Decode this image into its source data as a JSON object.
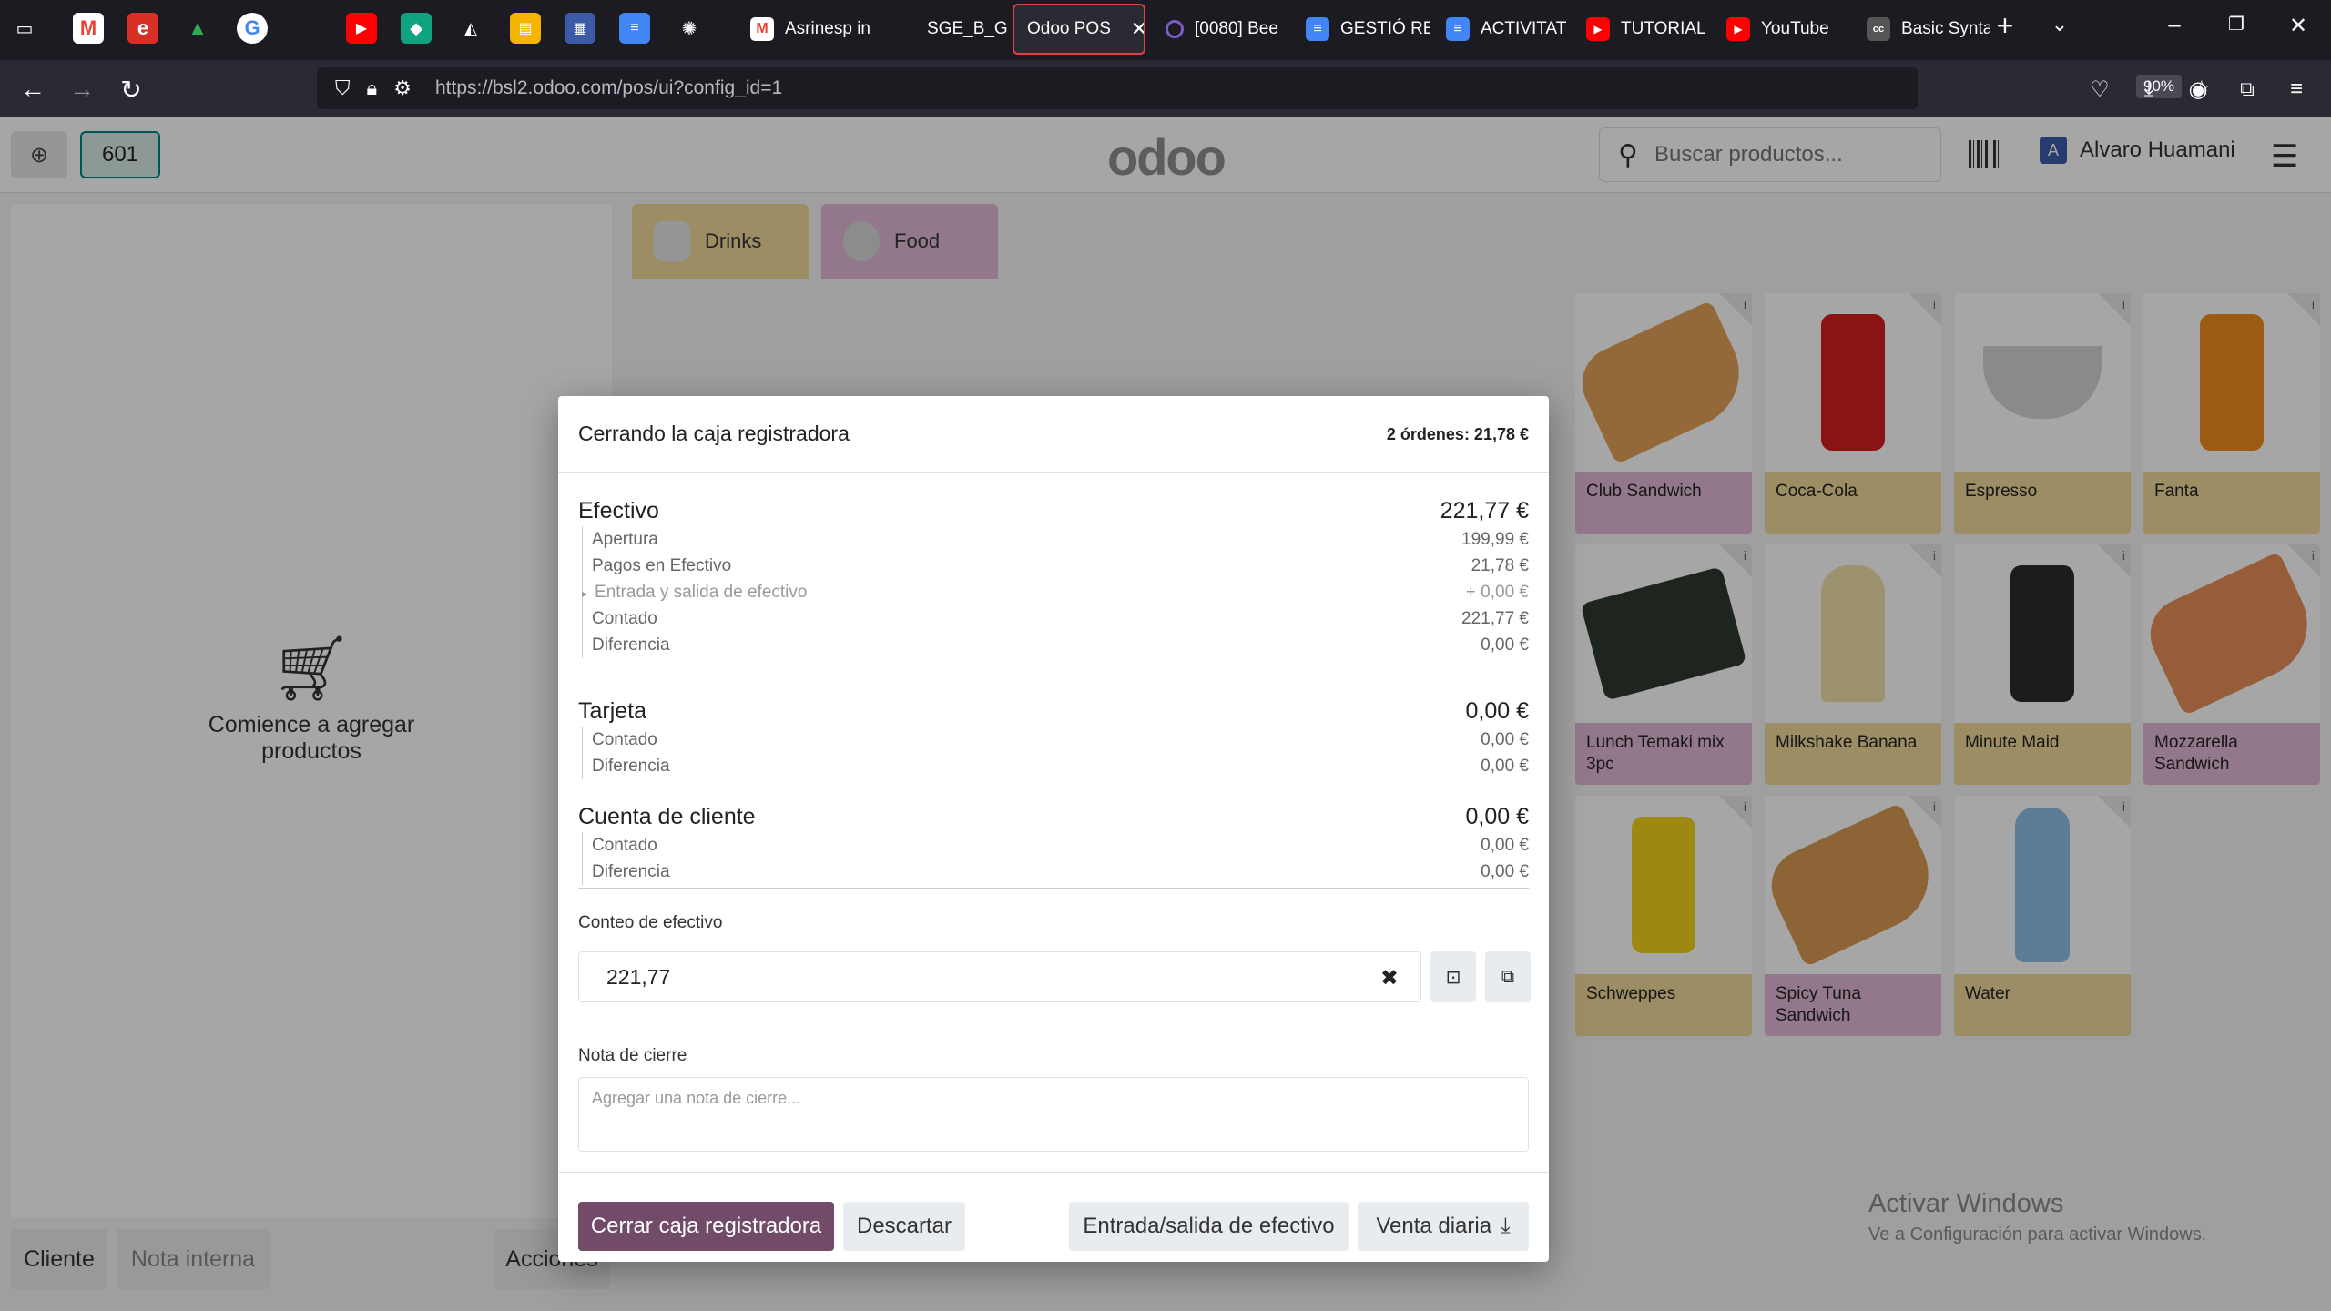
{
  "browser": {
    "tabs": [
      {
        "label": "Asrinesp in",
        "icon": "gmail-icon",
        "color": "#ea4335"
      },
      {
        "label": "SGE_B_GR",
        "icon": "odoo-icon",
        "color": "#714b67"
      },
      {
        "label": "Odoo POS",
        "icon": "",
        "color": "#714b67"
      },
      {
        "label": "[0080] Bee",
        "icon": "circle-icon",
        "color": "#7a5cc7"
      },
      {
        "label": "GESTIÓ RE",
        "icon": "docs-icon",
        "color": "#4285f4"
      },
      {
        "label": "ACTIVITAT",
        "icon": "docs-icon",
        "color": "#4285f4"
      },
      {
        "label": "TUTORIAL",
        "icon": "youtube-icon",
        "color": "#ff0000"
      },
      {
        "label": "YouTube",
        "icon": "youtube-icon",
        "color": "#ff0000"
      },
      {
        "label": "Basic Synta",
        "icon": "cc-icon",
        "color": "#555555"
      }
    ],
    "url": "https://bsl2.odoo.com/pos/ui?config_id=1",
    "zoom": "90%"
  },
  "pos": {
    "order_number": "601",
    "logo": "odoo",
    "search_placeholder": "Buscar productos...",
    "user_initial": "A",
    "user_name": "Alvaro Huamani",
    "empty_cart_text": "Comience a agregar productos",
    "bottom_buttons": {
      "customer": "Cliente",
      "internal_note": "Nota interna",
      "actions": "Acciones"
    },
    "categories": [
      {
        "label": "Drinks",
        "color": "#f0d99a"
      },
      {
        "label": "Food",
        "color": "#e2b9d6"
      }
    ],
    "products": [
      {
        "name": "Club Sandwich",
        "color": "#e2b9d6"
      },
      {
        "name": "Coca-Cola",
        "color": "#f0d99a"
      },
      {
        "name": "Espresso",
        "color": "#f0d99a"
      },
      {
        "name": "Fanta",
        "color": "#f0d99a"
      },
      {
        "name": "Lunch Temaki mix 3pc",
        "color": "#e2b9d6"
      },
      {
        "name": "Milkshake Banana",
        "color": "#f0d99a"
      },
      {
        "name": "Minute Maid",
        "color": "#f0d99a"
      },
      {
        "name": "Mozzarella Sandwich",
        "color": "#e2b9d6"
      },
      {
        "name": "Schweppes",
        "color": "#f0d99a"
      },
      {
        "name": "Spicy Tuna Sandwich",
        "color": "#e2b9d6"
      },
      {
        "name": "Water",
        "color": "#f0d99a"
      }
    ]
  },
  "dialog": {
    "title": "Cerrando la caja registradora",
    "orders_summary": "2 órdenes: 21,78 €",
    "cash": {
      "title": "Efectivo",
      "total": "221,77 €",
      "opening_label": "Apertura",
      "opening": "199,99 €",
      "payments_label": "Pagos en Efectivo",
      "payments": "21,78 €",
      "inout_label": "Entrada y salida de efectivo",
      "inout": "+ 0,00 €",
      "counted_label": "Contado",
      "counted": "221,77 €",
      "difference_label": "Diferencia",
      "difference": "0,00 €"
    },
    "card": {
      "title": "Tarjeta",
      "total": "0,00 €",
      "counted_label": "Contado",
      "counted": "0,00 €",
      "difference_label": "Diferencia",
      "difference": "0,00 €"
    },
    "customer_account": {
      "title": "Cuenta de cliente",
      "total": "0,00 €",
      "counted_label": "Contado",
      "counted": "0,00 €",
      "difference_label": "Diferencia",
      "difference": "0,00 €"
    },
    "cash_count_label": "Conteo de efectivo",
    "cash_count_value": "221,77",
    "closing_note_label": "Nota de cierre",
    "closing_note_placeholder": "Agregar una nota de cierre...",
    "buttons": {
      "close_register": "Cerrar caja registradora",
      "discard": "Descartar",
      "cash_in_out": "Entrada/salida de efectivo",
      "daily_sale": "Venta diaria"
    }
  },
  "watermark": {
    "title": "Activar Windows",
    "subtitle": "Ve a Configuración para activar Windows."
  }
}
